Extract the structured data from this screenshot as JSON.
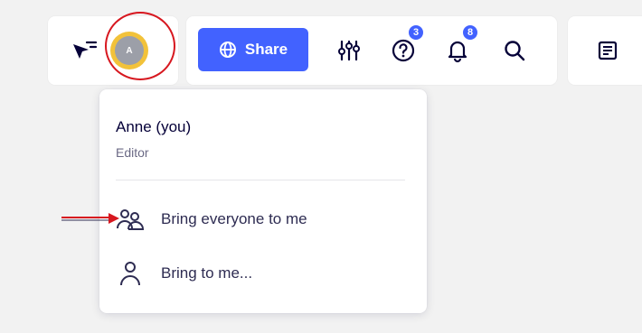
{
  "toolbar": {
    "share_label": "Share",
    "help_badge": "3",
    "notifications_badge": "8"
  },
  "avatar": {
    "initial": "A"
  },
  "dropdown": {
    "user_name": "Anne (you)",
    "user_role": "Editor",
    "items": [
      {
        "label": "Bring everyone to me",
        "icon": "users-icon"
      },
      {
        "label": "Bring to me...",
        "icon": "user-icon"
      }
    ]
  },
  "colors": {
    "accent": "#4262ff",
    "avatar_ring": "#f2c23a",
    "annotation_red": "#d7171f",
    "text_primary": "#050038",
    "text_secondary": "#6b6a85"
  }
}
